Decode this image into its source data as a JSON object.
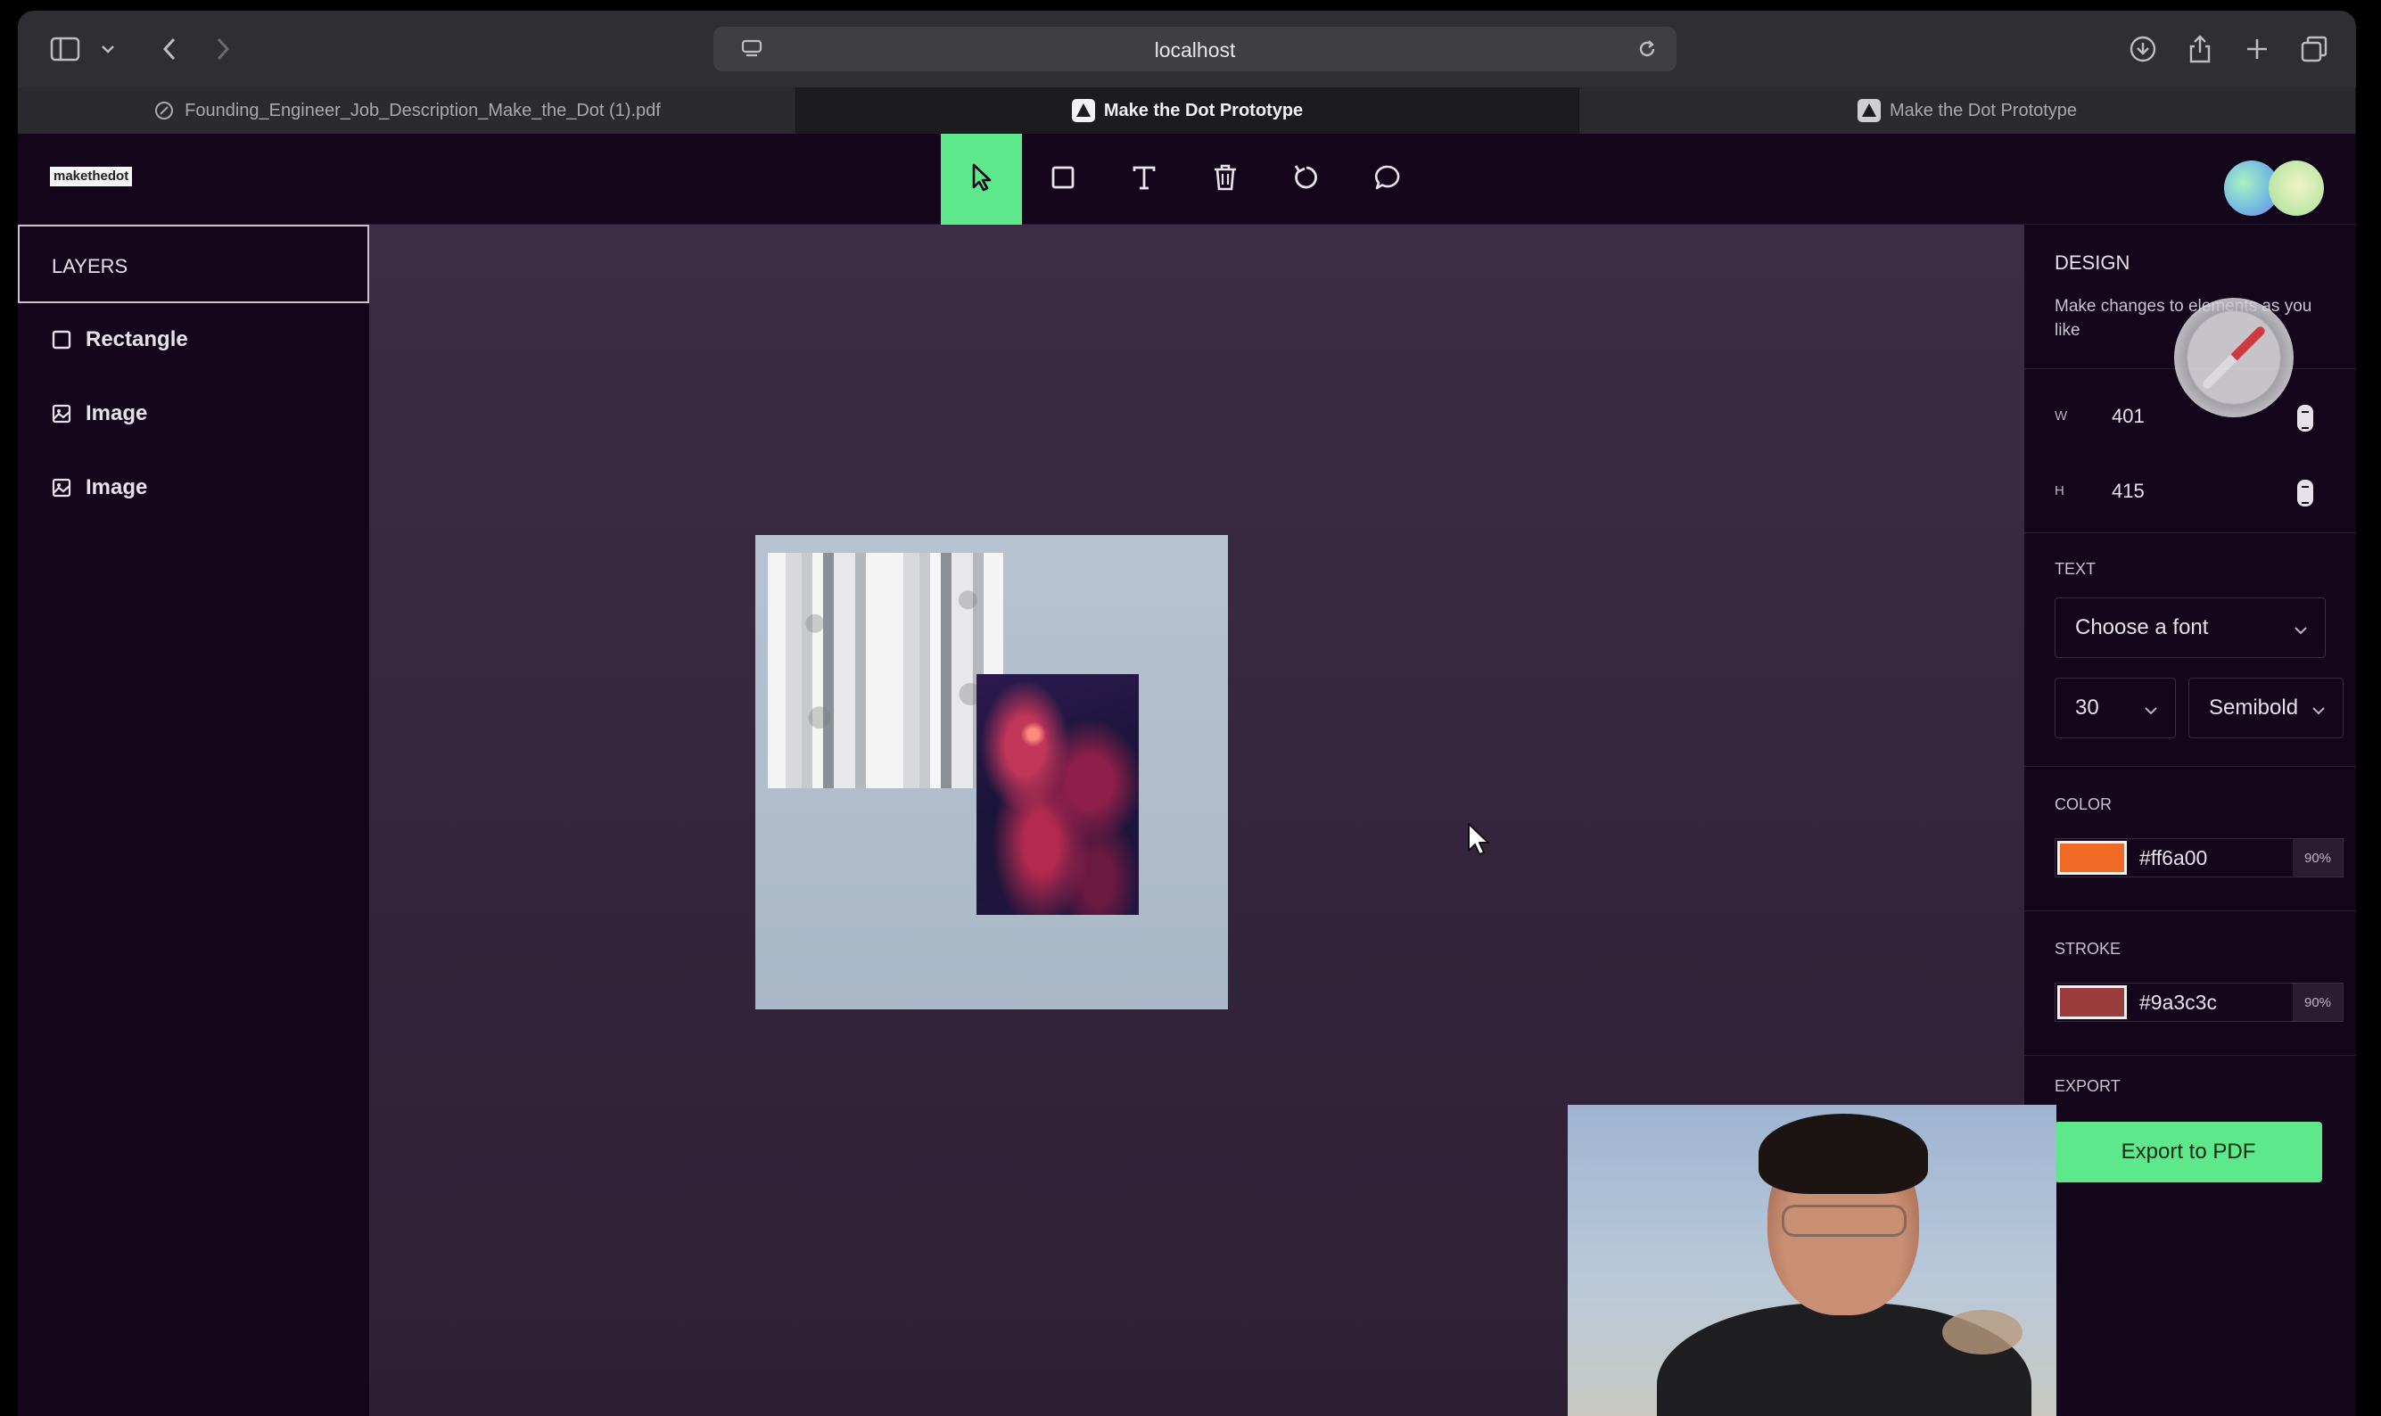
{
  "browser": {
    "address": "localhost",
    "tabs": [
      {
        "label": "Founding_Engineer_Job_Description_Make_the_Dot (1).pdf"
      },
      {
        "label": "Make the Dot Prototype"
      },
      {
        "label": "Make the Dot Prototype"
      }
    ]
  },
  "app": {
    "brand": "makethedot",
    "toolbar": {
      "tools": [
        "select-tool",
        "rectangle-tool",
        "text-tool",
        "delete-tool",
        "rotate-tool",
        "comment-tool"
      ],
      "active": "select-tool"
    }
  },
  "layers": {
    "title": "LAYERS",
    "items": [
      {
        "label": "Rectangle",
        "icon": "square-icon"
      },
      {
        "label": "Image",
        "icon": "image-icon"
      },
      {
        "label": "Image",
        "icon": "image-icon"
      }
    ]
  },
  "design": {
    "title": "DESIGN",
    "description": "Make changes to elements as you like",
    "width_key": "W",
    "width": "401",
    "height_key": "H",
    "height": "415",
    "text_label": "TEXT",
    "font_placeholder": "Choose a font",
    "font_size": "30",
    "font_weight": "Semibold",
    "color_label": "COLOR",
    "color_hex": "#ff6a00",
    "color_opacity": "90%",
    "stroke_label": "STROKE",
    "stroke_hex": "#9a3c3c",
    "stroke_opacity": "90%",
    "export_label": "EXPORT",
    "export_button": "Export to PDF"
  },
  "colors": {
    "accent": "#5ee88c",
    "fill_swatch": "#f06a25",
    "stroke_swatch": "#9a3c3c"
  }
}
